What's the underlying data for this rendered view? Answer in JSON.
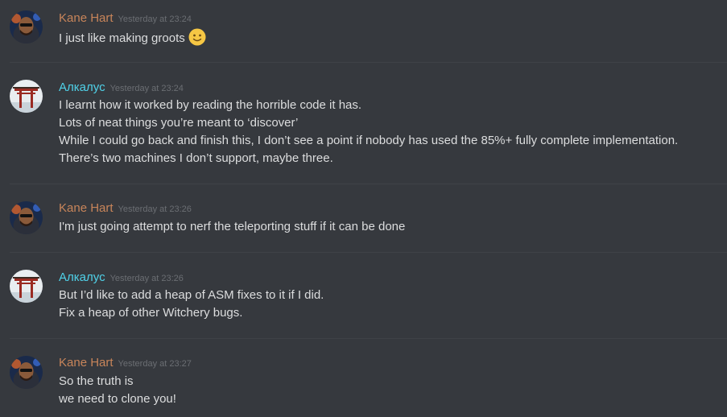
{
  "colors": {
    "background": "#36393e",
    "kane_name": "#c8855a",
    "alkalus_name": "#4fd1e8",
    "timestamp": "#6b6e73",
    "text": "#dcddde",
    "divider": "#3f4247"
  },
  "messages": [
    {
      "author": "Kane Hart",
      "timestamp": "Yesterday at 23:24",
      "lines": [
        "I just like making groots"
      ],
      "emoji": "slightly-smiling-face-icon"
    },
    {
      "author": "Алкалус",
      "timestamp": "Yesterday at 23:24",
      "lines": [
        "I learnt how it worked by reading the horrible code it has.",
        "Lots of neat things you’re meant to ‘discover’",
        "While I could go back and finish this, I don’t see a point if nobody has used the 85%+ fully complete implementation.",
        "There’s two machines I don’t support, maybe three."
      ]
    },
    {
      "author": "Kane Hart",
      "timestamp": "Yesterday at 23:26",
      "lines": [
        "I'm just going attempt to nerf the teleporting stuff if it can be done"
      ]
    },
    {
      "author": "Алкалус",
      "timestamp": "Yesterday at 23:26",
      "lines": [
        "But I’d like to add a heap of ASM fixes to it if I did.",
        "Fix a heap of other Witchery bugs."
      ]
    },
    {
      "author": "Kane Hart",
      "timestamp": "Yesterday at 23:27",
      "lines": [
        "So the truth is",
        "we need to clone you!"
      ]
    }
  ]
}
